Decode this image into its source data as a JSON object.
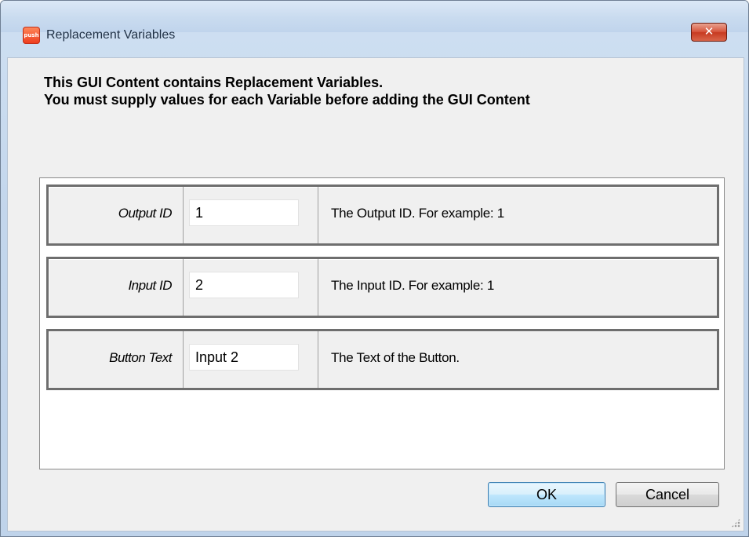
{
  "window": {
    "title": "Replacement Variables",
    "close_glyph": "✕",
    "icon_name": "push-app-icon",
    "icon_text": "push"
  },
  "message": {
    "line1": "This GUI Content contains Replacement Variables.",
    "line2": "You must supply values for each Variable before adding the GUI Content"
  },
  "variables": [
    {
      "label": "Output ID",
      "value": "1",
      "description": "The Output ID. For example: 1"
    },
    {
      "label": "Input ID",
      "value": "2",
      "description": "The Input ID. For example: 1"
    },
    {
      "label": "Button Text",
      "value": "Input 2",
      "description": "The Text of the Button."
    }
  ],
  "buttons": {
    "ok_label": "OK",
    "cancel_label": "Cancel"
  },
  "colors": {
    "close_button": "#c73a20",
    "ok_button_border": "#3c7fb1"
  }
}
